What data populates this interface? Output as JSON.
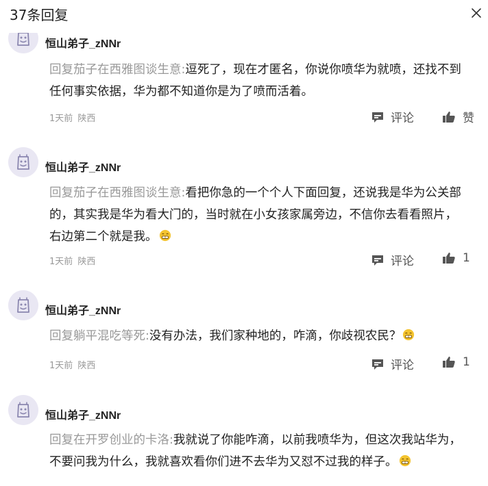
{
  "header": {
    "title": "37条回复",
    "close_icon": "close-icon"
  },
  "comments": [
    {
      "username": "恒山弟子_zNNr",
      "reply_prefix": "回复茄子在西雅图谈生意:",
      "text": "逗死了，现在才匿名，你说你喷华为就喷，还找不到任何事实依据，华为都不知道你是为了喷而活着。",
      "has_emoji": false,
      "time": "1天前",
      "location": "陕西",
      "comment_label": "评论",
      "like_label": "赞"
    },
    {
      "username": "恒山弟子_zNNr",
      "reply_prefix": "回复茄子在西雅图谈生意:",
      "text": "看把你急的一个个人下面回复，还说我是华为公关部的，其实我是华为看大门的，当时就在小女孩家属旁边，不信你去看看照片，右边第二个就是我。",
      "has_emoji": true,
      "time": "1天前",
      "location": "陕西",
      "comment_label": "评论",
      "like_label": "1"
    },
    {
      "username": "恒山弟子_zNNr",
      "reply_prefix": "回复躺平混吃等死:",
      "text": "没有办法，我们家种地的，咋滴，你歧视农民？",
      "has_emoji": true,
      "time": "1天前",
      "location": "陕西",
      "comment_label": "评论",
      "like_label": "1"
    },
    {
      "username": "恒山弟子_zNNr",
      "reply_prefix": "回复在开罗创业的卡洛:",
      "text": "我就说了你能咋滴，以前我喷华为，但这次我站华为，不要问我为什么，我就喜欢看你们进不去华为又怼不过我的样子。",
      "has_emoji": true
    }
  ],
  "icons": {
    "avatar": "avatar-icon",
    "comment": "comment-icon",
    "like": "thumbs-up-icon",
    "emoji": "grin-emoji-icon"
  },
  "colors": {
    "muted_text": "#999999",
    "body_text": "#222222",
    "avatar_bg": "#e9e7f3",
    "avatar_fg": "#8b87b0",
    "emoji": "#f4c430"
  }
}
